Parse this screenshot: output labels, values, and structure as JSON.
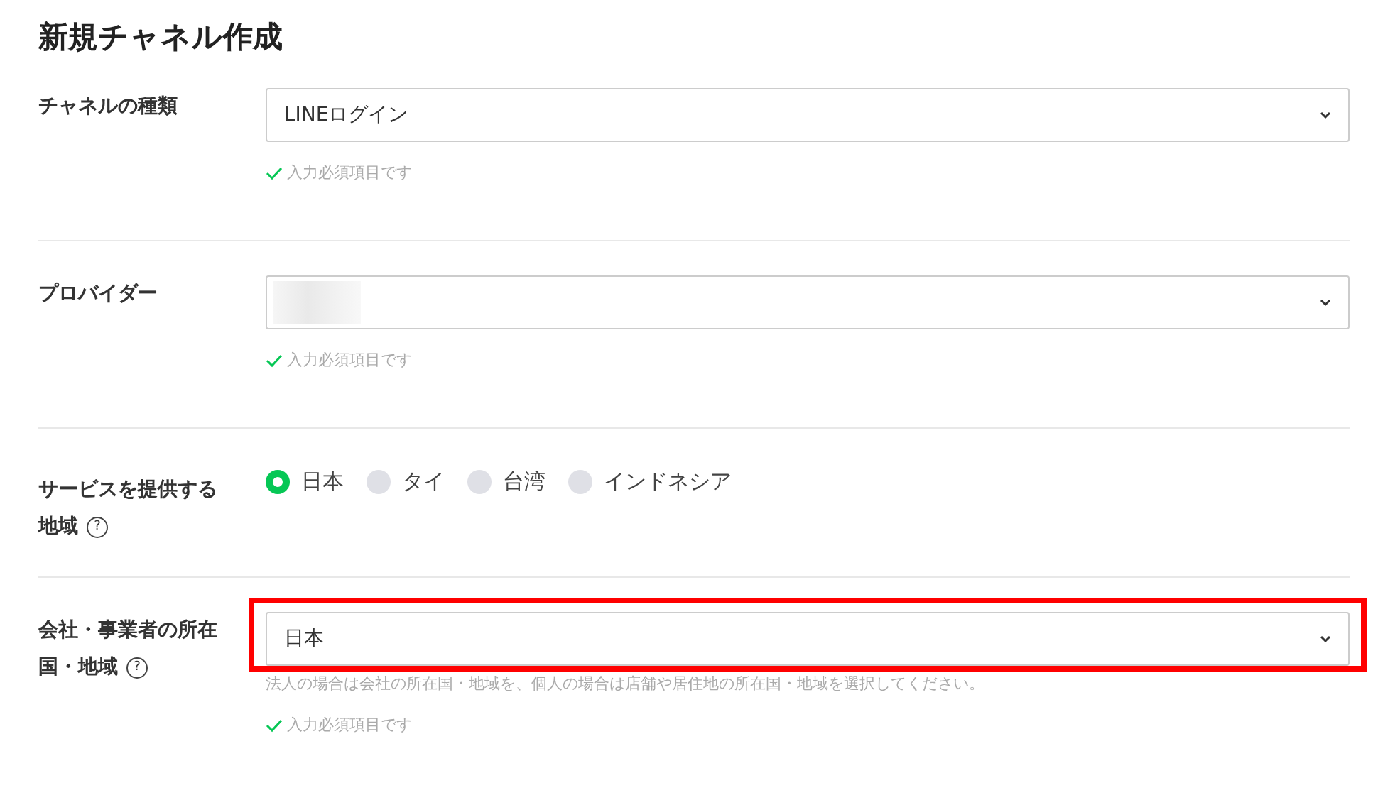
{
  "title": "新規チャネル作成",
  "fields": [
    {
      "kind": "select",
      "label": [
        "チャネルの種類"
      ],
      "value": "LINEログイン",
      "highlighted": false,
      "validation": "入力必須項目です"
    },
    {
      "kind": "select",
      "label": [
        "プロバイダー"
      ],
      "redacted": true,
      "highlighted": false,
      "validation": "入力必須項目です"
    },
    {
      "kind": "radio",
      "label": [
        "サービスを提供する",
        "地域"
      ],
      "help": "?",
      "options": [
        {
          "label": "日本",
          "selected": true
        },
        {
          "label": "タイ",
          "selected": false
        },
        {
          "label": "台湾",
          "selected": false
        },
        {
          "label": "インドネシア",
          "selected": false
        }
      ]
    },
    {
      "kind": "select",
      "label": [
        "会社・事業者の所在",
        "国・地域"
      ],
      "help": "?",
      "value": "日本",
      "highlighted": true,
      "note": "法人の場合は会社の所在国・地域を、個人の場合は店舗や居住地の所在国・地域を選択してください。",
      "validation": "入力必須項目です"
    }
  ]
}
